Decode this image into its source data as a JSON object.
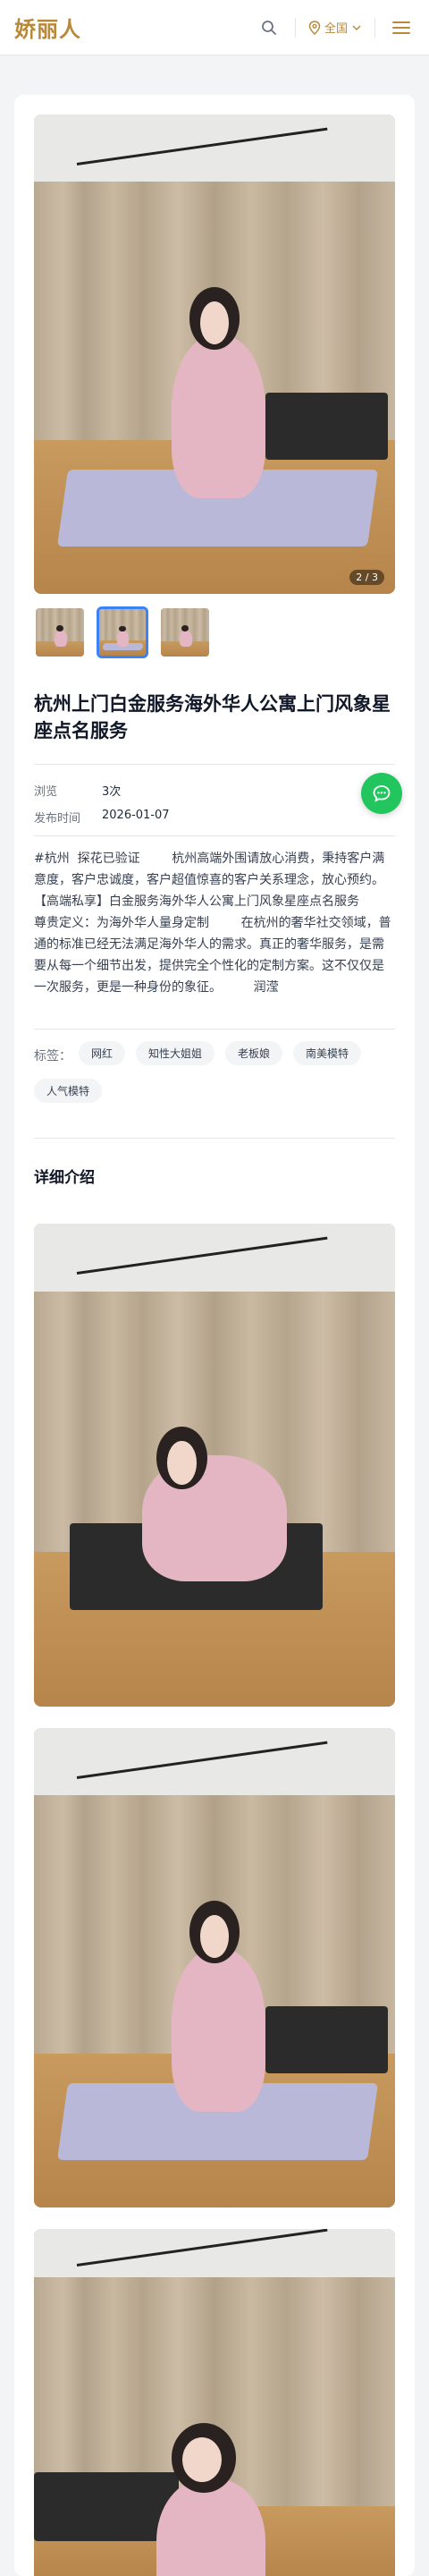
{
  "header": {
    "logo": "娇丽人",
    "region_label": "全国"
  },
  "gallery": {
    "counter": "2 / 3",
    "thumb_count": 3,
    "active_thumb": 2
  },
  "post": {
    "title": "杭州上门白金服务海外华人公寓上门风象星座点名服务",
    "meta": [
      {
        "label": "浏览",
        "value": "3次"
      },
      {
        "label": "发布时间",
        "value": "2026-01-07"
      }
    ],
    "description": "#杭州  探花已验证        杭州高端外围请放心消费，秉持客户满意度，客户忠诚度，客户超值惊喜的客户关系理念，放心预约。        【高端私享】白金服务海外华人公寓上门风象星座点名服务        尊贵定义：为海外华人量身定制        在杭州的奢华社交领域，普通的标准已经无法满足海外华人的需求。真正的奢华服务，是需要从每一个细节出发，提供完全个性化的定制方案。这不仅仅是一次服务，更是一种身份的象征。        润滢",
    "tags_label": "标签：",
    "tags": [
      "网红",
      "知性大姐姐",
      "老板娘",
      "南美模特",
      "人气模特"
    ]
  },
  "details": {
    "section_title": "详细介绍"
  },
  "colors": {
    "brand": "#b8893a",
    "accent": "#3b82f6",
    "fab": "#22c55e"
  },
  "icons": {
    "search": "search-icon",
    "location": "map-pin-icon",
    "chevron": "chevron-down-icon",
    "menu": "hamburger-menu-icon",
    "chat": "chat-bubble-icon"
  }
}
